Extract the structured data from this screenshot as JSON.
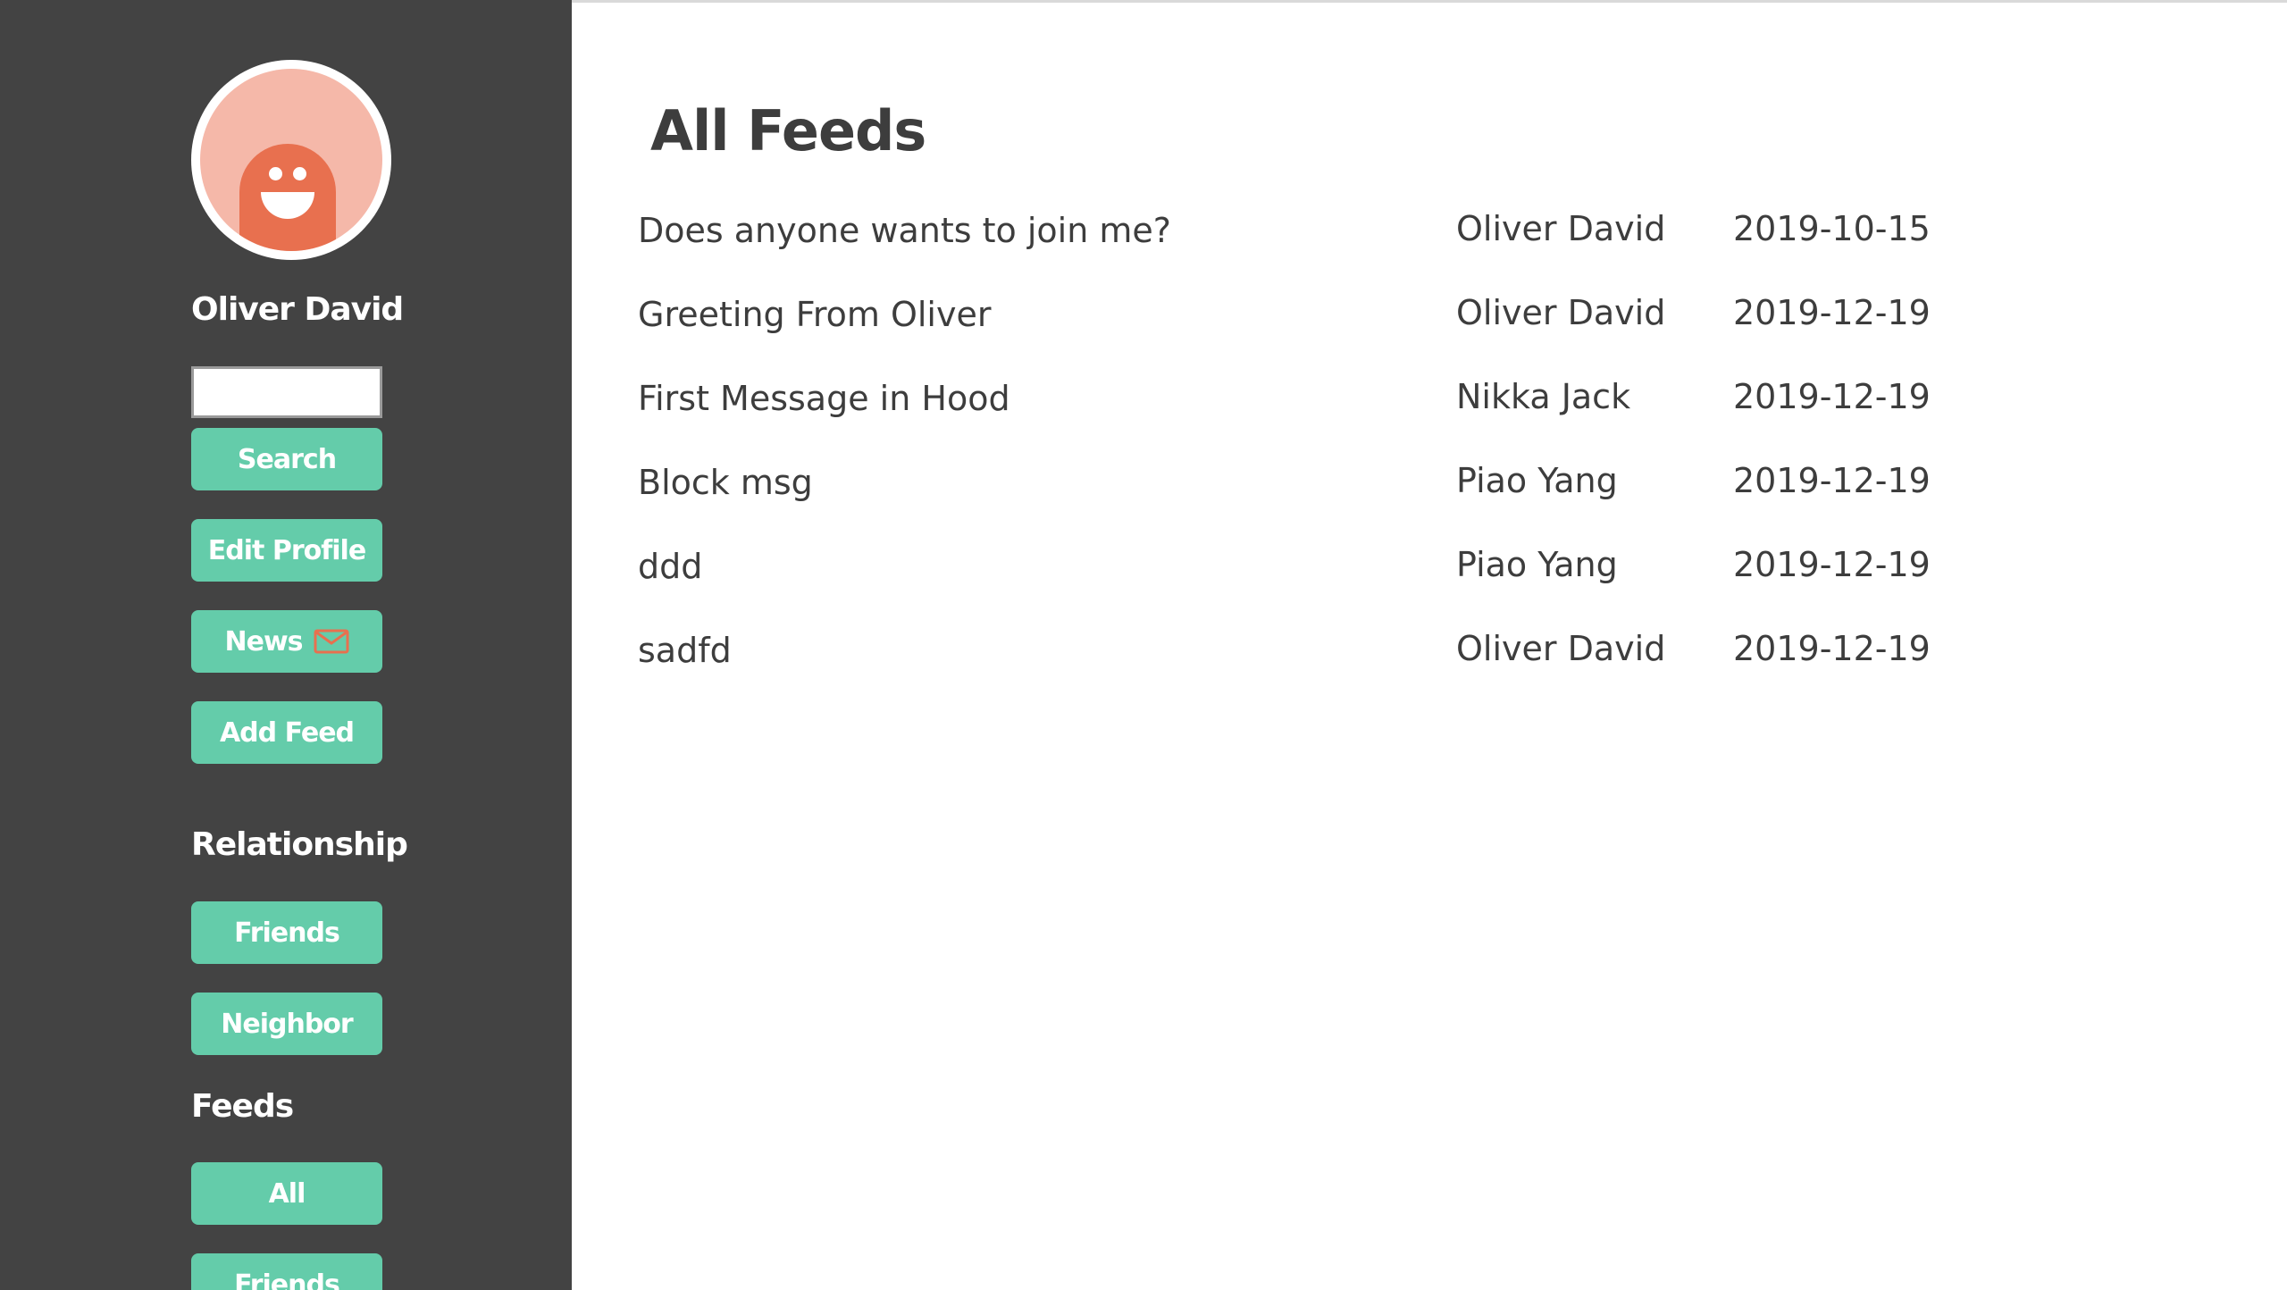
{
  "sidebar": {
    "username": "Oliver David",
    "search": {
      "value": "",
      "placeholder": ""
    },
    "buttons": {
      "search": "Search",
      "edit_profile": "Edit Profile",
      "news": "News",
      "add_feed": "Add Feed"
    },
    "news_icon": "mail-icon",
    "relationship": {
      "title": "Relationship",
      "items": [
        "Friends",
        "Neighbor"
      ]
    },
    "feeds": {
      "title": "Feeds",
      "items": [
        "All",
        "Friends"
      ]
    }
  },
  "main": {
    "title": "All Feeds",
    "feeds": [
      {
        "title": "Does anyone wants to join me?",
        "author": "Oliver David",
        "date": "2019-10-15"
      },
      {
        "title": "Greeting From Oliver",
        "author": "Oliver David",
        "date": "2019-12-19"
      },
      {
        "title": "First Message in Hood",
        "author": "Nikka Jack",
        "date": "2019-12-19"
      },
      {
        "title": "Block msg",
        "author": "Piao Yang",
        "date": "2019-12-19"
      },
      {
        "title": "ddd",
        "author": "Piao Yang",
        "date": "2019-12-19"
      },
      {
        "title": "sadfd",
        "author": "Oliver David",
        "date": "2019-12-19"
      }
    ]
  },
  "colors": {
    "sidebar_bg": "#434343",
    "button_bg": "#64ccaa",
    "avatar_bg": "#f5b8a9",
    "avatar_ghost": "#e8704f",
    "text_dark": "#3d3d3d"
  }
}
